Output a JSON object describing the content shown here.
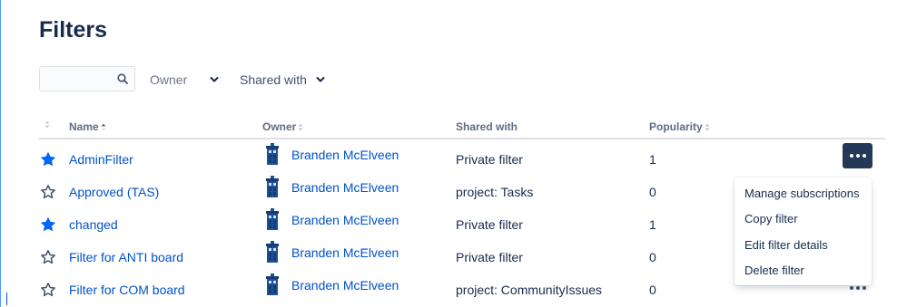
{
  "page": {
    "title": "Filters"
  },
  "toolbar": {
    "search": {
      "value": "",
      "placeholder": ""
    },
    "owner_label": "Owner",
    "shared_with_label": "Shared with"
  },
  "table": {
    "columns": [
      "Name",
      "Owner",
      "Shared with",
      "Popularity"
    ],
    "sorted_by": "Name",
    "rows": [
      {
        "starred": true,
        "name": "AdminFilter",
        "owner": "Branden McElveen",
        "shared_with": "Private filter",
        "popularity": "1"
      },
      {
        "starred": false,
        "name": "Approved (TAS)",
        "owner": "Branden McElveen",
        "shared_with": "project: Tasks",
        "popularity": "0"
      },
      {
        "starred": true,
        "name": "changed",
        "owner": "Branden McElveen",
        "shared_with": "Private filter",
        "popularity": "1"
      },
      {
        "starred": false,
        "name": "Filter for ANTI board",
        "owner": "Branden McElveen",
        "shared_with": "Private filter",
        "popularity": "0"
      },
      {
        "starred": false,
        "name": "Filter for COM board",
        "owner": "Branden McElveen",
        "shared_with": "project: CommunityIssues",
        "popularity": "0"
      }
    ]
  },
  "actions_menu": {
    "items": [
      "Manage subscriptions",
      "Copy filter",
      "Edit filter details",
      "Delete filter"
    ]
  },
  "icons": {
    "search": "search-icon",
    "chevron": "chevron-down-icon",
    "star_filled": "star-filled-icon",
    "star_outline": "star-outline-icon",
    "avatar": "tardis-avatar-icon",
    "more": "more-horizontal-icon"
  },
  "colors": {
    "link": "#0052cc",
    "heading": "#172b4d",
    "star": "#0065ff",
    "more_button_bg": "#253858",
    "avatar": "#1d4f91"
  }
}
